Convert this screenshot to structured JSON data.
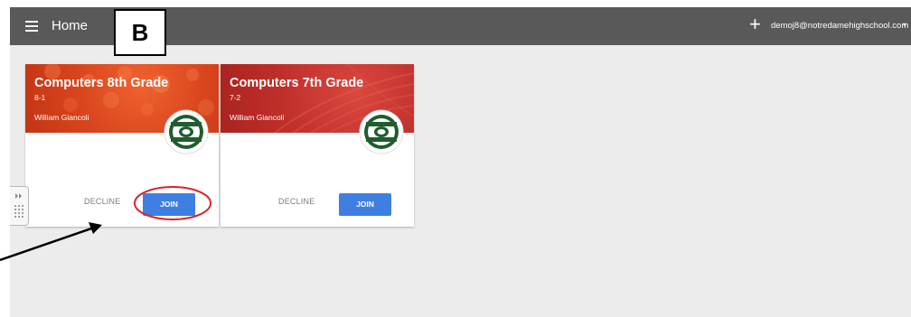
{
  "header": {
    "title": "Home",
    "add_symbol": "+",
    "account_email": "demoj8@notredamehighschool.com",
    "account_caret": "▾"
  },
  "cards": [
    {
      "title": "Computers 8th Grade",
      "section": "8-1",
      "teacher": "William Giancoli",
      "decline_label": "DECLINE",
      "join_label": "JOIN",
      "header_color": "#d7431c"
    },
    {
      "title": "Computers 7th Grade",
      "section": "7-2",
      "teacher": "William Giancoli",
      "decline_label": "DECLINE",
      "join_label": "JOIN",
      "header_color": "#bf2f2a"
    }
  ],
  "annotation": {
    "label": "B",
    "highlight_color": "#d9252a",
    "arrow_color": "#000000"
  },
  "colors": {
    "topbar": "#595959",
    "background": "#ececec",
    "join_button": "#3f7fe2"
  }
}
